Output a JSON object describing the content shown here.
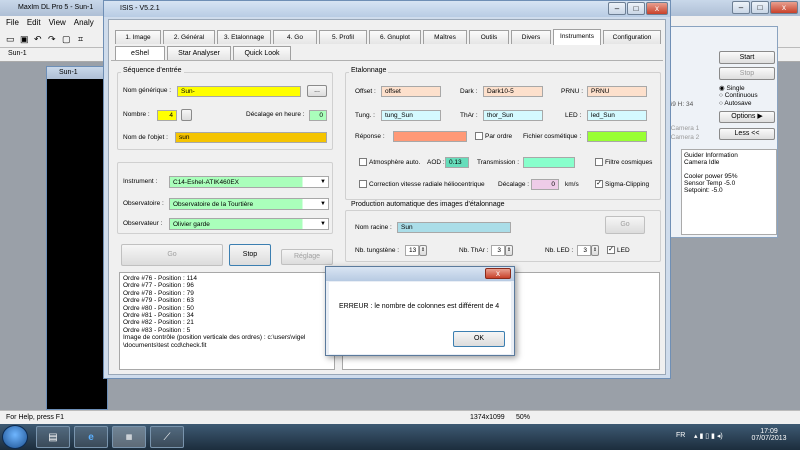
{
  "maxim": {
    "title": "MaxIm DL Pro 5 - Sun-1",
    "menu": [
      "File",
      "Edit",
      "View",
      "Analy"
    ],
    "doc_tab": "Sun-1",
    "sun_window_title": "Sun-1",
    "status_left": "For Help, press F1",
    "status_size": "1374x1099",
    "status_zoom": "50%"
  },
  "camera_panel": {
    "start": "Start",
    "stop": "Stop",
    "coord": "169 H: 34",
    "modes": [
      "Single",
      "Continuous",
      "Autosave"
    ],
    "options": "Options",
    "camera1": "Camera 1",
    "camera2": "Camera 2",
    "less": "Less <<",
    "info": [
      "Guider Information",
      "Camera Idle",
      "",
      "Cooler power 95%",
      "Sensor Temp -5.0",
      "Setpoint: -5.0"
    ]
  },
  "isis": {
    "title": "ISIS - V5.2.1",
    "tabs": [
      "1. Image",
      "2. Général",
      "3. Etalonnage",
      "4. Go",
      "5. Profil",
      "6. Gnuplot",
      "Maîtres",
      "Outils",
      "Divers",
      "Instruments",
      "Configuration"
    ],
    "subtabs": [
      "eShel",
      "Star Analyser",
      "Quick Look"
    ],
    "sequence": {
      "group": "Séquence d'entrée",
      "nom_generique_label": "Nom générique :",
      "nom_generique": "Sun-",
      "browse": "...",
      "nombre_label": "Nombre :",
      "nombre": "4",
      "decalage_label": "Décalage en heure :",
      "decalage": "0",
      "nom_objet_label": "Nom de l'objet :",
      "nom_objet": "sun"
    },
    "instrument": {
      "instrument_label": "Instrument :",
      "instrument": "C14-Eshel-ATIK460EX",
      "observatoire_label": "Observatoire :",
      "observatoire": "Observatoire de la Tourtière",
      "observateur_label": "Observateur :",
      "observateur": "Olivier garde"
    },
    "buttons": {
      "go": "Go",
      "stop": "Stop",
      "reglage": "Réglage"
    },
    "etalonnage": {
      "group": "Etalonnage",
      "offset_label": "Offset :",
      "offset": "offset",
      "dark_label": "Dark :",
      "dark": "Dark10-5",
      "prnu_label": "PRNU :",
      "prnu": "PRNU",
      "tung_label": "Tung. :",
      "tung": "tung_Sun",
      "thar_label": "ThAr :",
      "thar": "thor_Sun",
      "led_label": "LED :",
      "led": "led_Sun",
      "reponse_label": "Réponse :",
      "par_ordre": "Par ordre",
      "fichier_cosmetique": "Fichier cosmétique :",
      "atmosphere": "Atmosphère auto.",
      "aod_label": "AOD :",
      "aod": "0.13",
      "transmission_label": "Transmission :",
      "filtre_cosmiques": "Filtre cosmiques",
      "correction": "Correction vitesse radiale héliocentrique",
      "decalage_label": "Décalage :",
      "decalage": "0",
      "kms": "km/s",
      "sigma": "Sigma-Clipping"
    },
    "production": {
      "group": "Production automatique des images d'étalonnage",
      "nom_racine_label": "Nom racine :",
      "nom_racine": "Sun",
      "go": "Go",
      "nb_tungstene_label": "Nb. tungstène :",
      "nb_tungstene": "13",
      "nb_thar_label": "Nb. ThAr :",
      "nb_thar": "3",
      "nb_led_label": "Nb. LED :",
      "nb_led": "3",
      "led_chk": "LED"
    },
    "log_lines": [
      "Ordre #76 - Position : 114",
      "Ordre #77 - Position : 96",
      "Ordre #78 - Position : 79",
      "Ordre #79 - Position : 63",
      "Ordre #80 - Position : 50",
      "Ordre #81 - Position : 34",
      "Ordre #82 - Position : 21",
      "Ordre #83 - Position : 5",
      "Image de contrôle (position verticale des ordres) : c:\\users\\vigel",
      "\\documents\\test ccd\\check.fit"
    ]
  },
  "dialog": {
    "message": "ERREUR : le nombre de colonnes est différent de 4",
    "ok": "OK",
    "close": "x"
  },
  "taskbar": {
    "lang": "FR",
    "time": "17:09",
    "date": "07/07/2013"
  }
}
